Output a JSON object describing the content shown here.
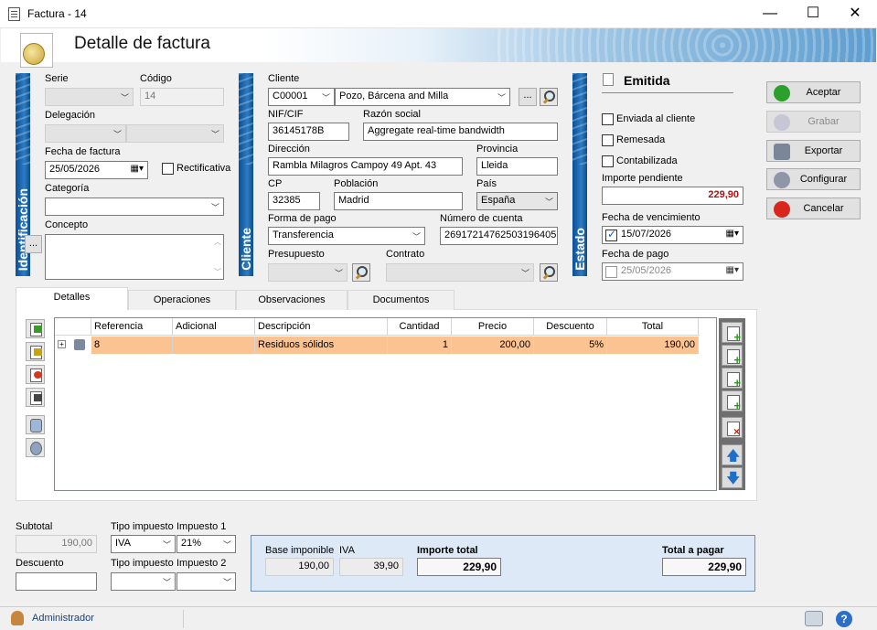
{
  "window": {
    "title": "Factura - 14",
    "minimize": "—",
    "maximize": "☐",
    "close": "✕"
  },
  "header": {
    "title": "Detalle de factura"
  },
  "sections": {
    "identificacion": "Identificación",
    "cliente": "Cliente",
    "estado": "Estado"
  },
  "ident": {
    "serie_label": "Serie",
    "serie_value": "",
    "codigo_label": "Código",
    "codigo_value": "14",
    "delegacion_label": "Delegación",
    "fecha_label": "Fecha de factura",
    "fecha_value": "25/05/2026",
    "rectificativa_label": "Rectificativa",
    "categoria_label": "Categoría",
    "categoria_value": "",
    "concepto_label": "Concepto",
    "concepto_value": "",
    "ellipsis": "..."
  },
  "cliente": {
    "cliente_label": "Cliente",
    "cliente_code": "C00001",
    "cliente_name": "Pozo, Bárcena and Milla",
    "ellipsis": "...",
    "nif_label": "NIF/CIF",
    "nif_value": "36145178B",
    "razon_label": "Razón social",
    "razon_value": "Aggregate real-time bandwidth",
    "direccion_label": "Dirección",
    "direccion_value": "Rambla Milagros Campoy 49 Apt. 43",
    "provincia_label": "Provincia",
    "provincia_value": "Lleida",
    "cp_label": "CP",
    "cp_value": "32385",
    "poblacion_label": "Población",
    "poblacion_value": "Madrid",
    "pais_label": "País",
    "pais_value": "España",
    "formapago_label": "Forma de pago",
    "formapago_value": "Transferencia",
    "cuenta_label": "Número de cuenta",
    "cuenta_value": "26917214762503196405",
    "presupuesto_label": "Presupuesto",
    "presupuesto_value": "",
    "contrato_label": "Contrato",
    "contrato_value": ""
  },
  "estado": {
    "status": "Emitida",
    "enviada_label": "Enviada al cliente",
    "enviada_checked": false,
    "remesada_label": "Remesada",
    "remesada_checked": false,
    "contabilizada_label": "Contabilizada",
    "contabilizada_checked": false,
    "importe_label": "Importe pendiente",
    "importe_value": "229,90",
    "vencimiento_label": "Fecha de vencimiento",
    "vencimiento_value": "15/07/2026",
    "vencimiento_checked": true,
    "pago_label": "Fecha de pago",
    "pago_value": "25/05/2026",
    "pago_checked": false
  },
  "actions": {
    "aceptar": "Aceptar",
    "grabar": "Grabar",
    "exportar": "Exportar",
    "configurar": "Configurar",
    "cancelar": "Cancelar"
  },
  "tabs": [
    "Detalles",
    "Operaciones",
    "Observaciones",
    "Documentos"
  ],
  "grid": {
    "columns": [
      "Referencia",
      "Adicional",
      "Descripción",
      "Cantidad",
      "Precio",
      "Descuento",
      "Total"
    ],
    "rows": [
      {
        "expand": "+",
        "referencia": "8",
        "adicional": "",
        "descripcion": "Residuos sólidos",
        "cantidad": "1",
        "precio": "200,00",
        "descuento": "5%",
        "total": "190,00"
      }
    ]
  },
  "totals": {
    "subtotal_label": "Subtotal",
    "subtotal_value": "190,00",
    "descuento_label": "Descuento",
    "descuento_value": "",
    "tipo1_label": "Tipo impuesto",
    "tipo1_value": "IVA",
    "imp1_label": "Impuesto 1",
    "imp1_value": "21%",
    "tipo2_label": "Tipo impuesto",
    "tipo2_value": "",
    "imp2_label": "Impuesto 2",
    "imp2_value": "",
    "base_label": "Base imponible",
    "base_value": "190,00",
    "iva_label": "IVA",
    "iva_value": "39,90",
    "importe_total_label": "Importe total",
    "importe_total_value": "229,90",
    "total_pagar_label": "Total a pagar",
    "total_pagar_value": "229,90"
  },
  "status": {
    "user": "Administrador",
    "help": "?"
  },
  "colors": {
    "accent_bar": "#1e63a8",
    "row_highlight": "#fcc392",
    "importe_pendiente": "#b01010",
    "totals_panel": "#dde9f6"
  }
}
